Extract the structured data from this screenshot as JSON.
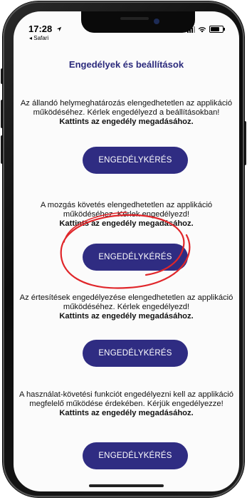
{
  "status_bar": {
    "time": "17:28",
    "back_app": "◂ Safari"
  },
  "header": {
    "title": "Engedélyek és beállítások"
  },
  "sections": [
    {
      "desc": "Az állandó helymeghatározás elengedhetetlen az applikáció működéséhez. Kérlek engedélyezd a beállításokban!",
      "cta": "Kattints az engedély megadásához.",
      "button": "ENGEDÉLYKÉRÉS"
    },
    {
      "desc": "A mozgás követés elengedhetetlen az applikáció működéséhez. Kérlek engedélyezd!",
      "cta": "Kattints az engedély megadásához.",
      "button": "ENGEDÉLYKÉRÉS"
    },
    {
      "desc": "Az értesítések engedélyezése elengedhetetlen az applikáció működéséhez. Kérlek engedélyezd!",
      "cta": "Kattints az engedély megadásához.",
      "button": "ENGEDÉLYKÉRÉS"
    },
    {
      "desc": "A használat-követési funkciót engedélyezni kell az applikáció megfelelő működése érdekében. Kérjük engedélyezze!",
      "cta": "Kattints az engedély megadásához.",
      "button": "ENGEDÉLYKÉRÉS"
    }
  ],
  "colors": {
    "accent": "#2f2c82",
    "title": "#2b2a7c",
    "annotation": "#e0262a"
  },
  "icons": {
    "location": "location-arrow-icon",
    "signal": "signal-bars-icon",
    "wifi": "wifi-icon",
    "battery": "battery-icon"
  }
}
